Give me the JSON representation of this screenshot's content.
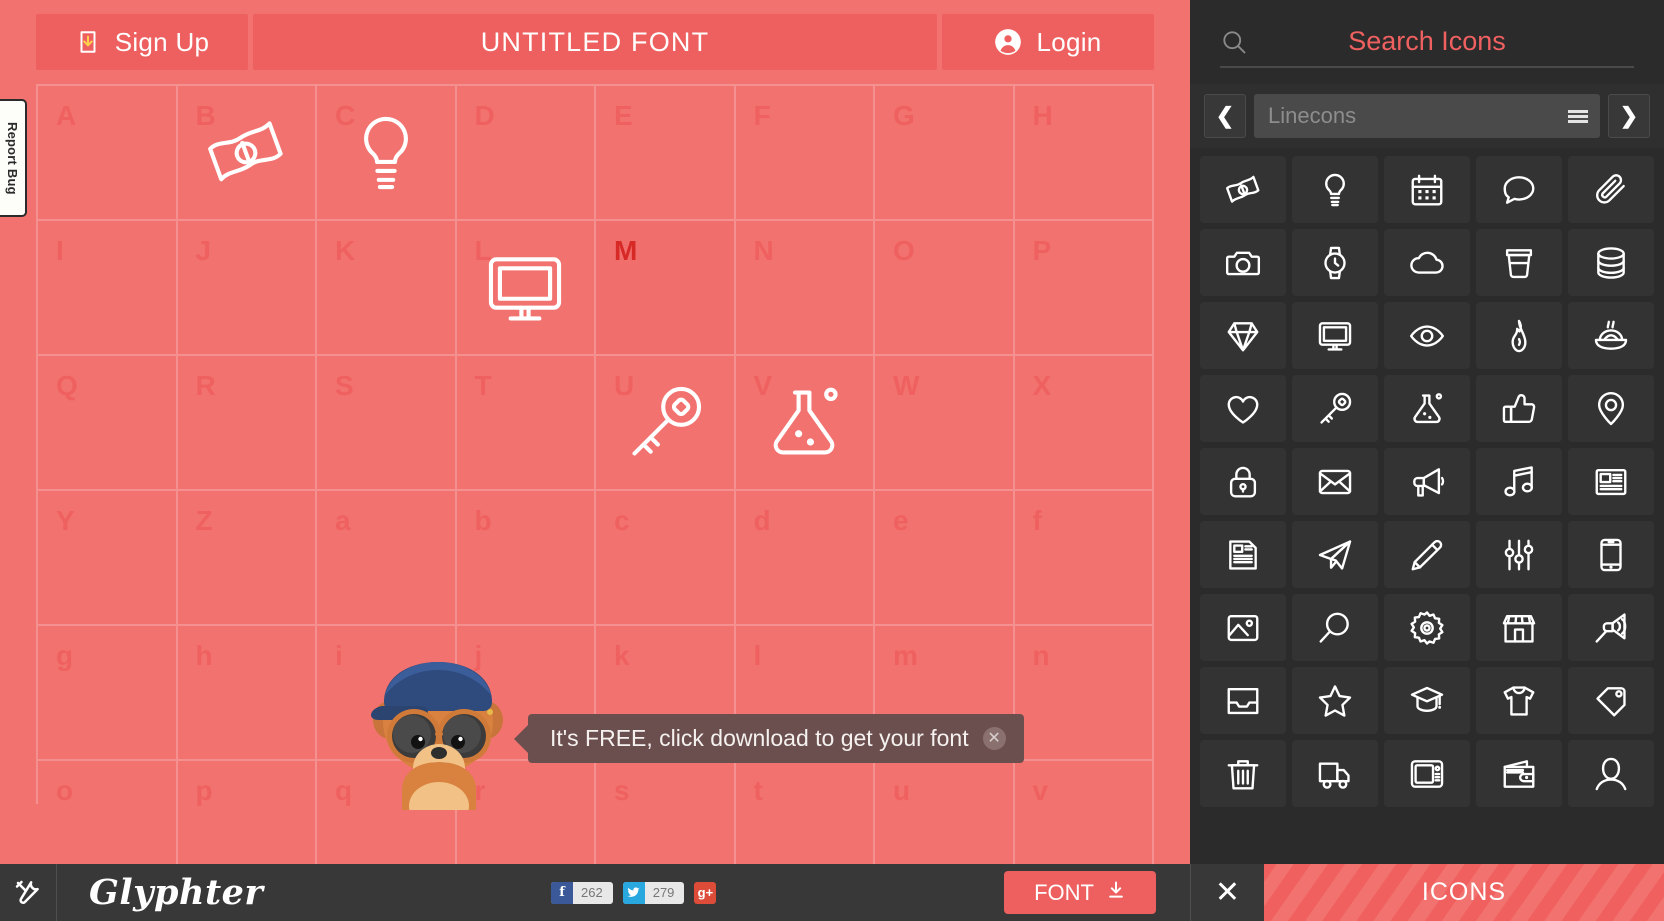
{
  "topbar": {
    "signup_label": "Sign Up",
    "signup_icon": "download-box-icon",
    "font_title": "UNTITLED FONT",
    "login_label": "Login",
    "login_icon": "user-circle-icon"
  },
  "report_bug": {
    "label": "Report Bug"
  },
  "grid": {
    "cells": [
      {
        "letter": "A",
        "glyph": null,
        "active": false
      },
      {
        "letter": "B",
        "glyph": "money",
        "active": false
      },
      {
        "letter": "C",
        "glyph": "bulb",
        "active": false
      },
      {
        "letter": "D",
        "glyph": null,
        "active": false
      },
      {
        "letter": "E",
        "glyph": null,
        "active": false
      },
      {
        "letter": "F",
        "glyph": null,
        "active": false
      },
      {
        "letter": "G",
        "glyph": null,
        "active": false
      },
      {
        "letter": "H",
        "glyph": null,
        "active": false
      },
      {
        "letter": "I",
        "glyph": null,
        "active": false
      },
      {
        "letter": "J",
        "glyph": null,
        "active": false
      },
      {
        "letter": "K",
        "glyph": null,
        "active": false
      },
      {
        "letter": "L",
        "glyph": "monitor",
        "active": false
      },
      {
        "letter": "M",
        "glyph": null,
        "active": true
      },
      {
        "letter": "N",
        "glyph": null,
        "active": false
      },
      {
        "letter": "O",
        "glyph": null,
        "active": false
      },
      {
        "letter": "P",
        "glyph": null,
        "active": false
      },
      {
        "letter": "Q",
        "glyph": null,
        "active": false
      },
      {
        "letter": "R",
        "glyph": null,
        "active": false
      },
      {
        "letter": "S",
        "glyph": null,
        "active": false
      },
      {
        "letter": "T",
        "glyph": null,
        "active": false
      },
      {
        "letter": "U",
        "glyph": "key",
        "active": false
      },
      {
        "letter": "V",
        "glyph": "flask",
        "active": false
      },
      {
        "letter": "W",
        "glyph": null,
        "active": false
      },
      {
        "letter": "X",
        "glyph": null,
        "active": false
      },
      {
        "letter": "Y",
        "glyph": null,
        "active": false
      },
      {
        "letter": "Z",
        "glyph": null,
        "active": false
      },
      {
        "letter": "a",
        "glyph": null,
        "active": false
      },
      {
        "letter": "b",
        "glyph": null,
        "active": false
      },
      {
        "letter": "c",
        "glyph": null,
        "active": false
      },
      {
        "letter": "d",
        "glyph": null,
        "active": false
      },
      {
        "letter": "e",
        "glyph": null,
        "active": false
      },
      {
        "letter": "f",
        "glyph": null,
        "active": false
      },
      {
        "letter": "g",
        "glyph": null,
        "active": false
      },
      {
        "letter": "h",
        "glyph": null,
        "active": false
      },
      {
        "letter": "i",
        "glyph": null,
        "active": false
      },
      {
        "letter": "j",
        "glyph": null,
        "active": false
      },
      {
        "letter": "k",
        "glyph": null,
        "active": false
      },
      {
        "letter": "l",
        "glyph": null,
        "active": false
      },
      {
        "letter": "m",
        "glyph": null,
        "active": false
      },
      {
        "letter": "n",
        "glyph": null,
        "active": false
      },
      {
        "letter": "o",
        "glyph": null,
        "active": false
      },
      {
        "letter": "p",
        "glyph": null,
        "active": false
      },
      {
        "letter": "q",
        "glyph": null,
        "active": false
      },
      {
        "letter": "r",
        "glyph": null,
        "active": false
      },
      {
        "letter": "s",
        "glyph": null,
        "active": false
      },
      {
        "letter": "t",
        "glyph": null,
        "active": false
      },
      {
        "letter": "u",
        "glyph": null,
        "active": false
      },
      {
        "letter": "v",
        "glyph": null,
        "active": false
      }
    ]
  },
  "tooltip": {
    "text": "It's FREE, click download to get your font",
    "close_icon": "close-circle-icon"
  },
  "right_panel": {
    "search": {
      "placeholder": "Search Icons",
      "value": "",
      "icon": "search-icon"
    },
    "fontset": {
      "name": "Linecons",
      "prev_icon": "chevron-left-icon",
      "next_icon": "chevron-right-icon",
      "menu_icon": "hamburger-icon"
    },
    "icons": [
      "money",
      "bulb",
      "calendar",
      "speech-bubble",
      "paperclip",
      "camera",
      "watch",
      "cloud",
      "coffee-cup",
      "database",
      "diamond",
      "monitor",
      "eye",
      "fire",
      "food-bowl",
      "heart",
      "key",
      "flask",
      "thumbs-up",
      "map-pin",
      "lock",
      "envelope",
      "megaphone",
      "music-note",
      "newspaper",
      "article",
      "paper-plane",
      "pencil",
      "sliders",
      "mobile",
      "image",
      "magnifier",
      "gear",
      "store",
      "megaphone-muted",
      "inbox",
      "star",
      "graduation-cap",
      "t-shirt",
      "price-tag",
      "trash",
      "truck",
      "tv",
      "wallet",
      "user"
    ]
  },
  "bottombar": {
    "tools_icon": "tools-icon",
    "logo": "Glyphter",
    "social": {
      "facebook": {
        "label": "f",
        "count": "262",
        "color": "#3b5998"
      },
      "twitter": {
        "label": "t",
        "count": "279",
        "color": "#29a8e0"
      },
      "gplus": {
        "label": "g+",
        "color": "#dd4b39"
      }
    },
    "font_button": {
      "label": "FONT",
      "icon": "download-icon"
    },
    "close_icon": "close-icon",
    "icons_tab": "ICONS"
  },
  "colors": {
    "accent_red": "#f2726f",
    "accent_red_dark": "#ee605f",
    "panel_dark": "#2b2b2b",
    "bottom_dark": "#383838"
  }
}
